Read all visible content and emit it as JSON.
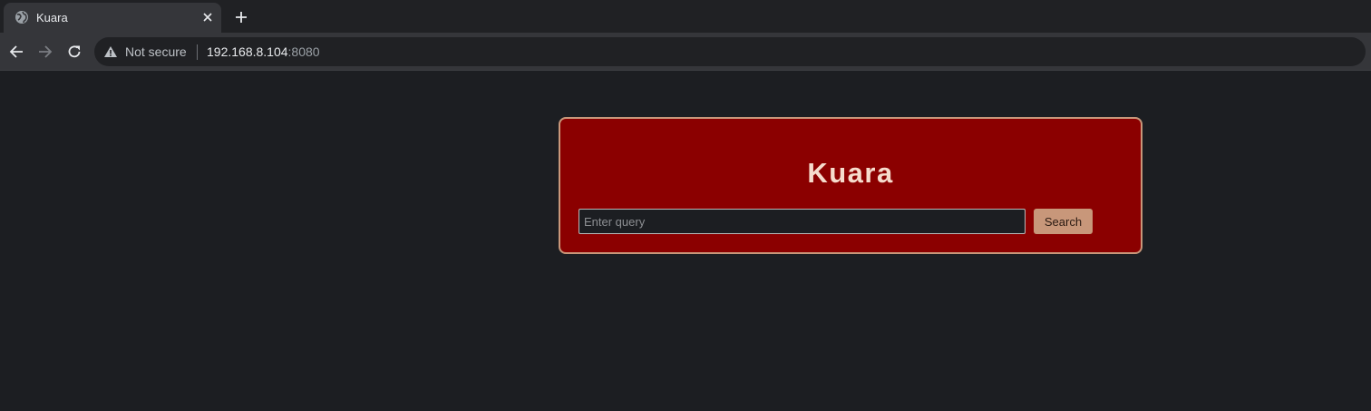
{
  "browser": {
    "tab": {
      "title": "Kuara",
      "favicon": "globe-icon",
      "close_icon": "close-icon"
    },
    "new_tab_icon": "plus-icon",
    "nav": {
      "back_icon": "arrow-left-icon",
      "forward_icon": "arrow-right-icon",
      "reload_icon": "reload-icon"
    },
    "address_bar": {
      "security_icon": "warning-triangle-icon",
      "security_label": "Not secure",
      "host": "192.168.8.104",
      "port": ":8080"
    }
  },
  "page": {
    "card": {
      "title": "Kuara",
      "search_input": {
        "value": "",
        "placeholder": "Enter query"
      },
      "search_button_label": "Search"
    }
  },
  "colors": {
    "page_background": "#1c1e22",
    "card_background": "#8b0000",
    "card_border": "#c8977a",
    "title_text": "#f6dccd",
    "button_background": "#c8977a"
  }
}
